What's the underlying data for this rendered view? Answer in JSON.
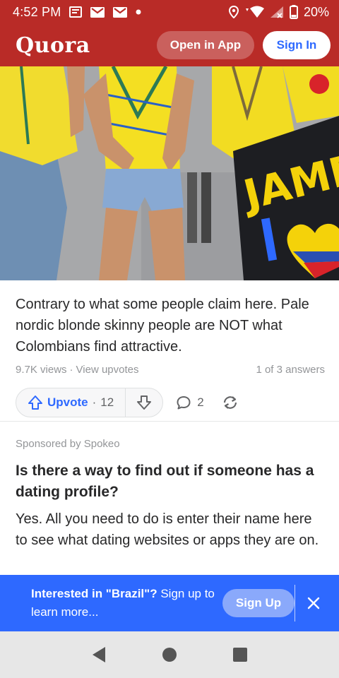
{
  "status_bar": {
    "time": "4:52 PM",
    "battery": "20%"
  },
  "header": {
    "logo": "Quora",
    "open_in_app": "Open in App",
    "sign_in": "Sign In"
  },
  "hero": {
    "sign_text": "JAME"
  },
  "answer": {
    "text": "Contrary to what some people claim here. Pale nordic blonde skinny people are NOT what Colombians find attractive.",
    "views": "9.7K views",
    "dot": "·",
    "view_upvotes": "View upvotes",
    "position": "1 of 3 answers",
    "upvote_label": "Upvote",
    "upvote_sep": "·",
    "upvote_count": "12",
    "comment_count": "2"
  },
  "sponsored": {
    "label": "Sponsored by Spokeo",
    "title": "Is there a way to find out if someone has a dating profile?",
    "body": "Yes. All you need to do is enter their name here to see what dating websites or apps they are on."
  },
  "banner": {
    "prefix": "Interested in \"Brazil\"?",
    "suffix": " Sign up to learn more...",
    "sign_up": "Sign Up"
  },
  "colors": {
    "brand_red": "#b92b27",
    "accent_blue": "#2e69ff"
  },
  "icons": [
    "notification-icon",
    "gmail-icon",
    "location-icon",
    "wifi-icon",
    "signal-icon",
    "battery-icon",
    "upvote-icon",
    "downvote-icon",
    "comment-icon",
    "share-icon",
    "close-icon",
    "back-icon",
    "home-icon",
    "recents-icon"
  ]
}
